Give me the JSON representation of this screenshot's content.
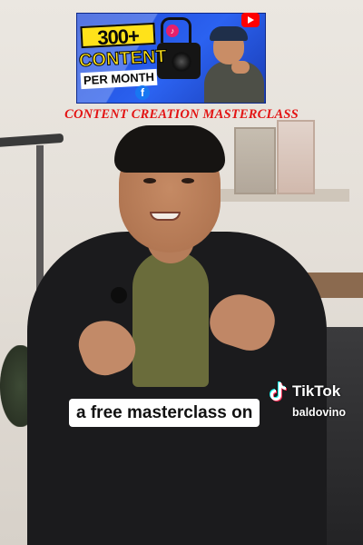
{
  "thumbnail": {
    "count": "300+",
    "content": "CONTENT",
    "per_month": "PER MONTH",
    "fb_glyph": "f",
    "tiktok_glyph": "♪"
  },
  "title": "CONTENT CREATION MASTERCLASS",
  "caption": "a free masterclass on",
  "watermark": {
    "brand": "TikTok",
    "username": "baldovino",
    "icon": "tiktok-icon"
  },
  "colors": {
    "title": "#e31414",
    "thumb_blue": "#2b62f0",
    "thumb_yellow": "#ffe21a"
  }
}
